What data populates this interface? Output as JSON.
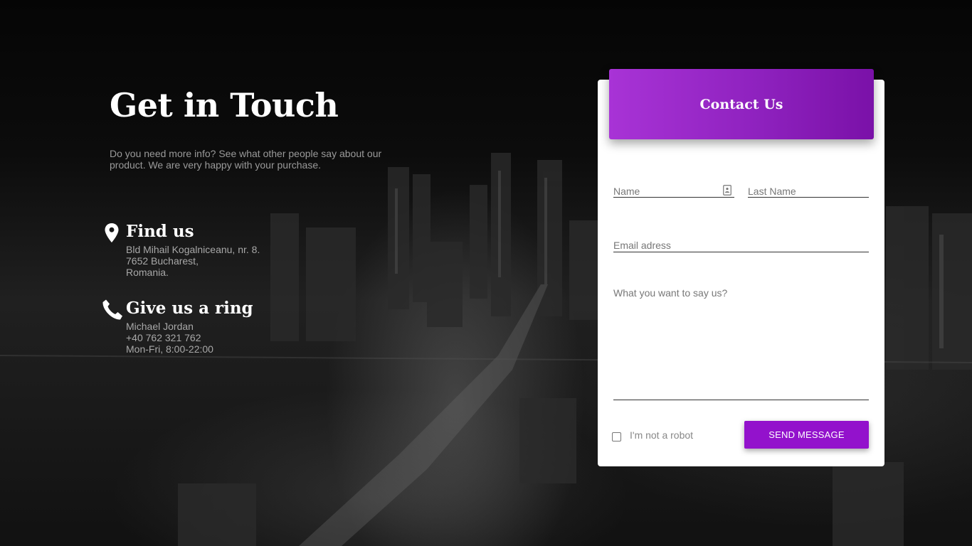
{
  "hero": {
    "title": "Get in Touch",
    "intro": "Do you need more info? See what other people say about our product. We are very happy with your purchase."
  },
  "find_us": {
    "icon": "map-pin-icon",
    "title": "Find us",
    "lines": [
      "Bld Mihail Kogalniceanu, nr. 8.",
      "7652 Bucharest,",
      "Romania."
    ]
  },
  "ring": {
    "icon": "phone-icon",
    "title": "Give us a ring",
    "lines": [
      "Michael Jordan",
      "+40 762 321 762",
      "Mon-Fri, 8:00-22:00"
    ]
  },
  "form": {
    "header": "Contact Us",
    "name_placeholder": "Name",
    "lastname_placeholder": "Last Name",
    "email_placeholder": "Email adress",
    "message_placeholder": "What you want to say us?",
    "robot_label": "I'm not a robot",
    "robot_checked": false,
    "submit_label": "SEND MESSAGE"
  },
  "colors": {
    "accent": "#9312cc",
    "header_gradient_start": "#a833d6",
    "header_gradient_end": "#7a11a8",
    "background": "#0c0c0c",
    "card": "#ffffff"
  }
}
